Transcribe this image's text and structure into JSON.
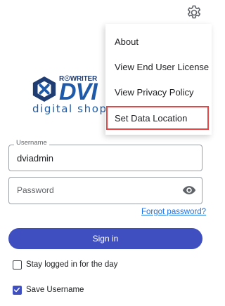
{
  "menu": {
    "items": [
      {
        "label": "About"
      },
      {
        "label": "View End User License"
      },
      {
        "label": "View Privacy Policy"
      },
      {
        "label": "Set Data Location"
      }
    ],
    "highlight_color": "#e0484a"
  },
  "logo": {
    "brand_top": "R☉WRITER",
    "brand_big": "DVI",
    "tagline": "digital shop r"
  },
  "login": {
    "username_label": "Username",
    "username_value": "dviadmin",
    "password_placeholder": "Password",
    "forgot_link": "Forgot password?",
    "sign_in_button": "Sign in",
    "stay_logged_in": "Stay logged in for the day",
    "stay_logged_in_checked": false,
    "save_username": "Save Username",
    "save_username_checked": true
  },
  "colors": {
    "primary": "#3f4fbf",
    "link": "#1a73e8"
  },
  "icons": {
    "settings": "gear-icon",
    "show_password": "eye-icon",
    "check": "check-icon"
  }
}
